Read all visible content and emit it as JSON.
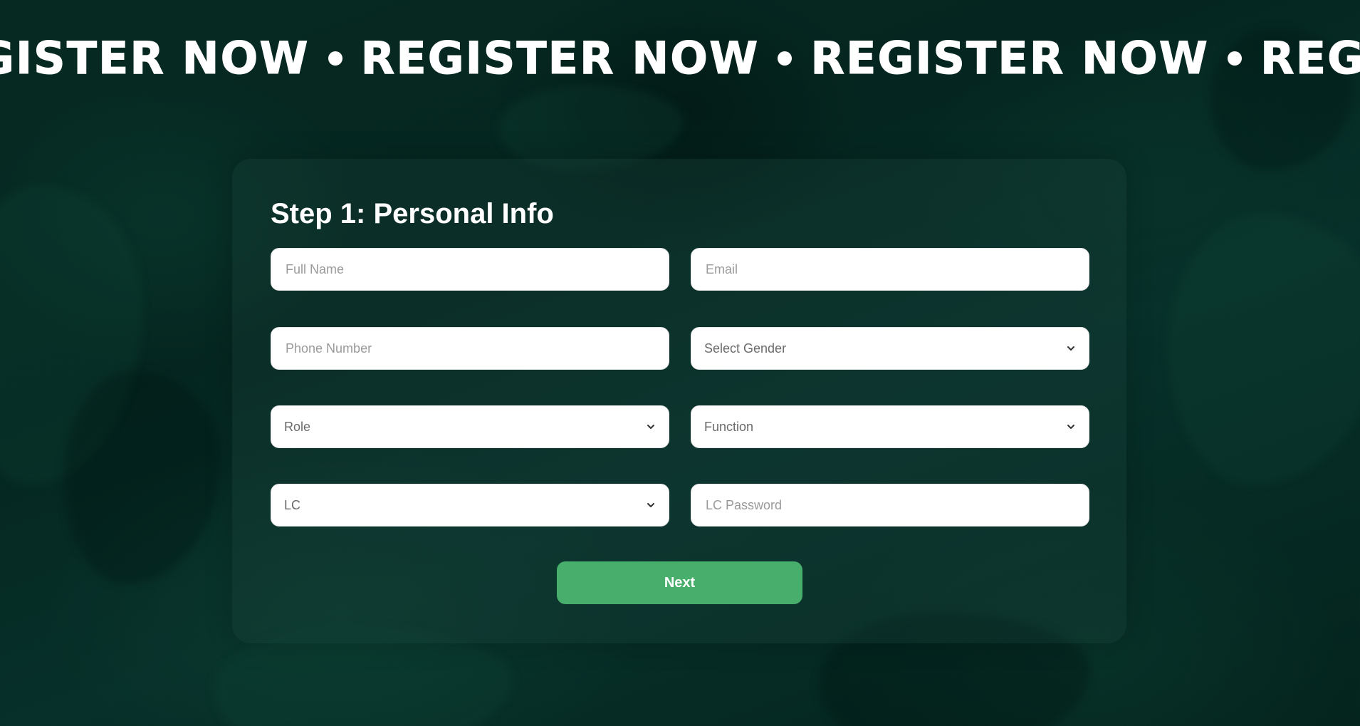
{
  "banner": {
    "items": [
      "REGISTER NOW",
      "REGISTER NOW",
      "REGISTER NOW",
      "REGISTER NOW"
    ]
  },
  "form": {
    "title": "Step 1: Personal Info",
    "full_name": {
      "value": "",
      "placeholder": "Full Name"
    },
    "email": {
      "value": "",
      "placeholder": "Email"
    },
    "phone": {
      "value": "",
      "placeholder": "Phone Number"
    },
    "gender": {
      "selected": "Select Gender"
    },
    "role": {
      "selected": "Role"
    },
    "function": {
      "selected": "Function"
    },
    "lc": {
      "selected": "LC"
    },
    "lc_password": {
      "value": "",
      "placeholder": "LC Password"
    },
    "next_label": "Next"
  },
  "colors": {
    "background": "#052620",
    "button": "#48ae6c",
    "text": "#ffffff"
  }
}
